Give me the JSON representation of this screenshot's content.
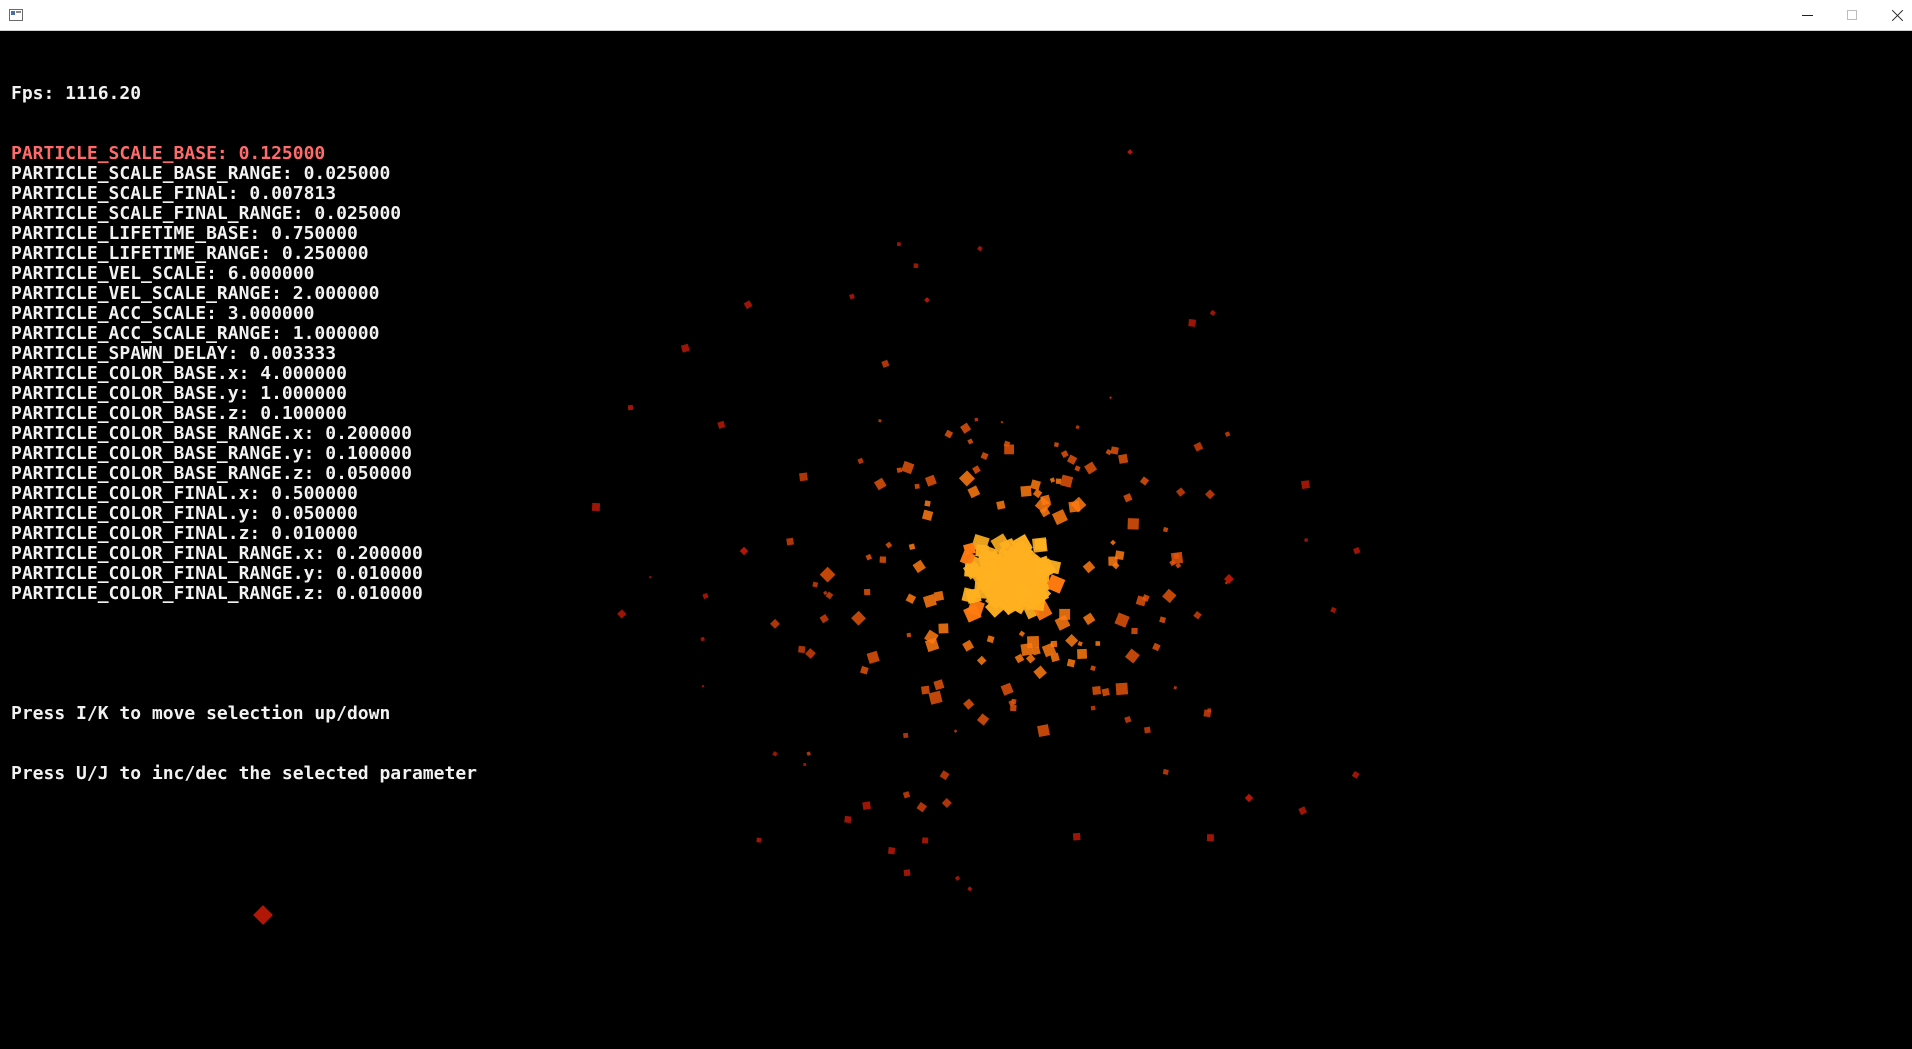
{
  "window": {
    "title": "",
    "controls": {
      "minimize": "minimize-icon",
      "maximize": "maximize-icon",
      "close": "close-icon"
    }
  },
  "hud": {
    "fps": "Fps: 1116.20",
    "selected_index": 0,
    "params": [
      "PARTICLE_SCALE_BASE: 0.125000",
      "PARTICLE_SCALE_BASE_RANGE: 0.025000",
      "PARTICLE_SCALE_FINAL: 0.007813",
      "PARTICLE_SCALE_FINAL_RANGE: 0.025000",
      "PARTICLE_LIFETIME_BASE: 0.750000",
      "PARTICLE_LIFETIME_RANGE: 0.250000",
      "PARTICLE_VEL_SCALE: 6.000000",
      "PARTICLE_VEL_SCALE_RANGE: 2.000000",
      "PARTICLE_ACC_SCALE: 3.000000",
      "PARTICLE_ACC_SCALE_RANGE: 1.000000",
      "PARTICLE_SPAWN_DELAY: 0.003333",
      "PARTICLE_COLOR_BASE.x: 4.000000",
      "PARTICLE_COLOR_BASE.y: 1.000000",
      "PARTICLE_COLOR_BASE.z: 0.100000",
      "PARTICLE_COLOR_BASE_RANGE.x: 0.200000",
      "PARTICLE_COLOR_BASE_RANGE.y: 0.100000",
      "PARTICLE_COLOR_BASE_RANGE.z: 0.050000",
      "PARTICLE_COLOR_FINAL.x: 0.500000",
      "PARTICLE_COLOR_FINAL.y: 0.050000",
      "PARTICLE_COLOR_FINAL.z: 0.010000",
      "PARTICLE_COLOR_FINAL_RANGE.x: 0.200000",
      "PARTICLE_COLOR_FINAL_RANGE.y: 0.010000",
      "PARTICLE_COLOR_FINAL_RANGE.z: 0.010000"
    ],
    "help": [
      "Press I/K to move selection up/down",
      "Press U/J to inc/dec the selected parameter"
    ]
  },
  "colors": {
    "background": "#000000",
    "text": "#f2f2f2",
    "selected_text": "#ff6b6b",
    "particle_hot": "#ffb020",
    "particle_mid": "#ff7a10",
    "particle_cool": "#c41a08"
  }
}
